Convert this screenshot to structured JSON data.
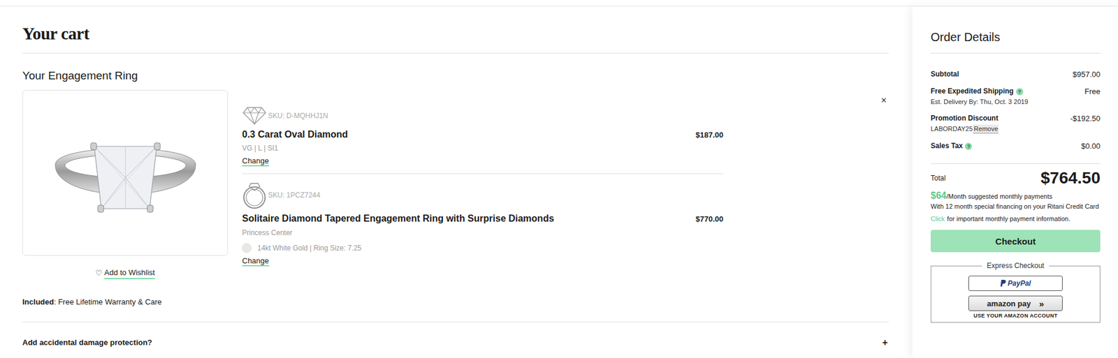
{
  "cart": {
    "title": "Your cart",
    "section": "Your Engagement Ring",
    "remove": "×",
    "wishlist": {
      "icon": "♡",
      "label": "Add to Wishlist"
    },
    "items": [
      {
        "kind": "diamond",
        "sku": "SKU: D-MQHHJ1N",
        "name": "0.3 Carat Oval Diamond",
        "price": "$187.00",
        "subtitle": "",
        "details": "VG | L | SI1",
        "change": "Change"
      },
      {
        "kind": "ring",
        "sku": "SKU: 1PCZ7244",
        "name": "Solitaire Diamond Tapered Engagement Ring with Surprise Diamonds",
        "price": "$770.00",
        "subtitle": "Princess Center",
        "details": "14kt White Gold | Ring Size: 7.25",
        "change": "Change"
      }
    ],
    "included": {
      "label": "Included",
      "text": ": Free Lifetime Warranty & Care"
    },
    "protection": {
      "label": "Add accidental damage protection?",
      "icon": "+",
      "expanded": false
    }
  },
  "order": {
    "title": "Order Details",
    "rows": [
      {
        "label": "Subtotal",
        "help": "",
        "value": "$957.00",
        "note": "",
        "code": "",
        "action": ""
      },
      {
        "label": "Free Expedited Shipping",
        "help": "?",
        "value": "Free",
        "note": "Est. Delivery By: Thu, Oct. 3 2019",
        "code": "",
        "action": ""
      },
      {
        "label": "Promotion Discount",
        "help": "",
        "value": "-$192.50",
        "note": "",
        "code": "LABORDAY25",
        "action": "Remove"
      },
      {
        "label": "Sales Tax",
        "help": "?",
        "value": "$0.00",
        "note": "",
        "code": "",
        "action": ""
      }
    ],
    "total": {
      "label": "Total",
      "value": "$764.50"
    },
    "financing": {
      "amount": "$64",
      "per": "/Month suggested monthly payments",
      "text": "With 12 month special financing on your Ritani Credit Card",
      "link": "Click",
      "link_text": "for important monthly payment information."
    },
    "checkout": "Checkout",
    "express": {
      "title": "Express Checkout",
      "paypal": "PayPal",
      "amazon": "amazon pay",
      "amazon_icon": "»",
      "amazon_note": "USE YOUR AMAZON ACCOUNT"
    }
  }
}
